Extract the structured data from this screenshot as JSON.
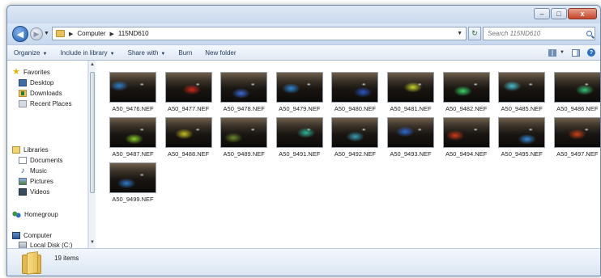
{
  "window": {
    "buttons": {
      "minimize": "–",
      "maximize": "□",
      "close": "x"
    }
  },
  "navigation": {
    "back_icon": "back-arrow-icon",
    "forward_icon": "forward-arrow-icon",
    "breadcrumb": [
      "Computer",
      "115ND610"
    ],
    "search_placeholder": "Search 115ND610"
  },
  "toolbar": {
    "organize": "Organize",
    "include_in_library": "Include in library",
    "share_with": "Share with",
    "burn": "Burn",
    "new_folder": "New folder"
  },
  "sidebar": {
    "favorites": {
      "label": "Favorites",
      "items": [
        "Desktop",
        "Downloads",
        "Recent Places"
      ]
    },
    "libraries": {
      "label": "Libraries",
      "items": [
        "Documents",
        "Music",
        "Pictures",
        "Videos"
      ]
    },
    "homegroup": "Homegroup",
    "computer": {
      "label": "Computer",
      "items": [
        "Local Disk (C:)"
      ]
    }
  },
  "files": [
    {
      "name": "A50_9476.NEF",
      "glow": "#2f7fd0"
    },
    {
      "name": "A50_9477.NEF",
      "glow": "#d02a1a"
    },
    {
      "name": "A50_9478.NEF",
      "glow": "#3a6fd8"
    },
    {
      "name": "A50_9479.NEF",
      "glow": "#2f8ad8"
    },
    {
      "name": "A50_9480.NEF",
      "glow": "#2a58c8"
    },
    {
      "name": "A50_9481.NEF",
      "glow": "#c8d82a"
    },
    {
      "name": "A50_9482.NEF",
      "glow": "#3ad86a"
    },
    {
      "name": "A50_9485.NEF",
      "glow": "#4ac0d0"
    },
    {
      "name": "A50_9486.NEF",
      "glow": "#38c878"
    },
    {
      "name": "A50_9487.NEF",
      "glow": "#8ad02a"
    },
    {
      "name": "A50_9488.NEF",
      "glow": "#c8c020"
    },
    {
      "name": "A50_9489.NEF",
      "glow": "#6a8a2a"
    },
    {
      "name": "A50_9491.NEF",
      "glow": "#2ab89a"
    },
    {
      "name": "A50_9492.NEF",
      "glow": "#3aa0b8"
    },
    {
      "name": "A50_9493.NEF",
      "glow": "#2a6ad8"
    },
    {
      "name": "A50_9494.NEF",
      "glow": "#d03a1a"
    },
    {
      "name": "A50_9495.NEF",
      "glow": "#3a8ad8"
    },
    {
      "name": "A50_9497.NEF",
      "glow": "#d0401a"
    },
    {
      "name": "A50_9499.NEF",
      "glow": "#2f7ad0"
    }
  ],
  "status": {
    "item_count": "19 items"
  },
  "colors": {
    "accent": "#1e395b",
    "window_frame": "#6f8bab"
  }
}
